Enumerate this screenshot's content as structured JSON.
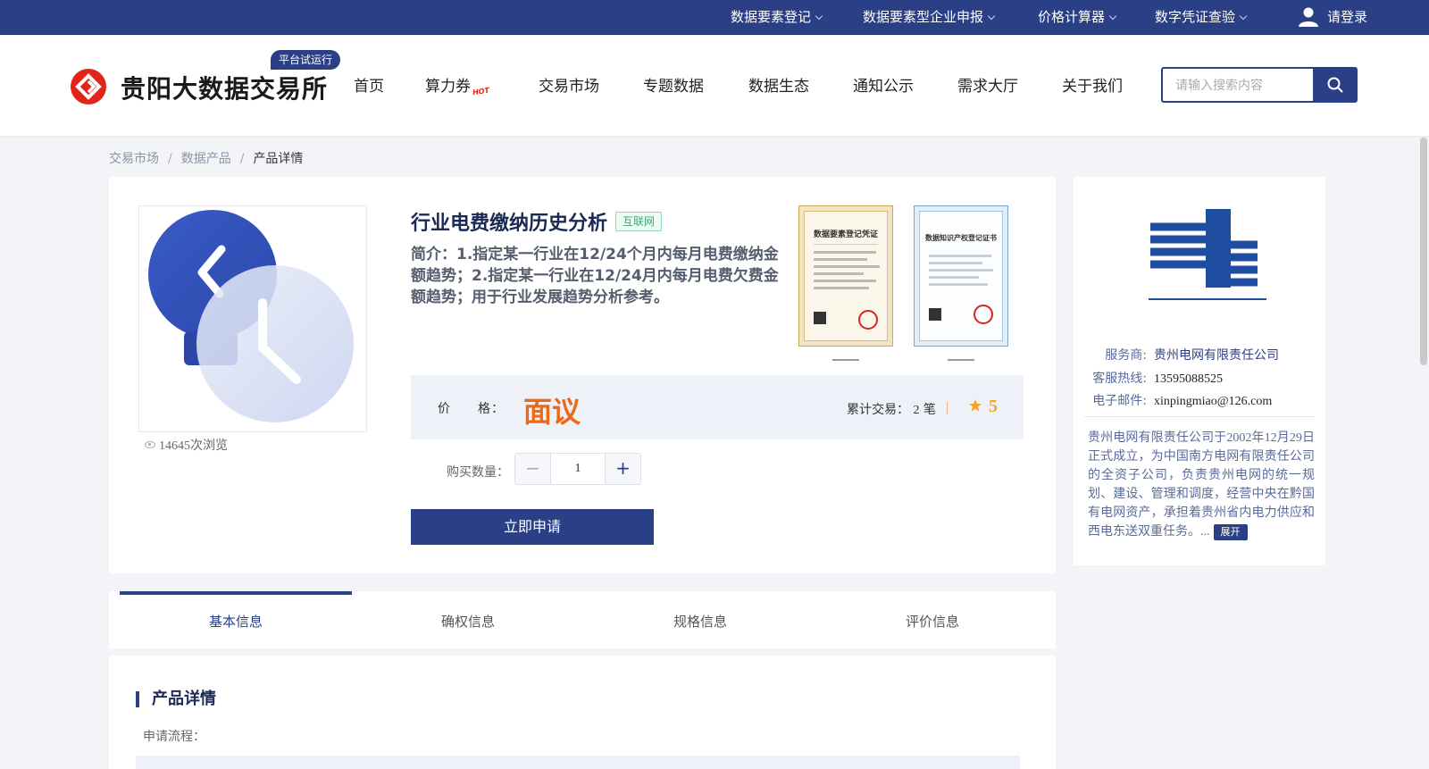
{
  "topbar": {
    "items": [
      {
        "label": "数据要素登记"
      },
      {
        "label": "数据要素型企业申报"
      },
      {
        "label": "价格计算器"
      },
      {
        "label": "数字凭证查验"
      }
    ],
    "login_label": "请登录"
  },
  "header": {
    "logo_text": "贵阳大数据交易所",
    "trial_badge": "平台试运行",
    "nav": [
      {
        "label": "首页"
      },
      {
        "label": "算力券",
        "hot": "HOT"
      },
      {
        "label": "交易市场"
      },
      {
        "label": "专题数据"
      },
      {
        "label": "数据生态"
      },
      {
        "label": "通知公示"
      },
      {
        "label": "需求大厅"
      },
      {
        "label": "关于我们"
      }
    ],
    "search_placeholder": "请输入搜索内容"
  },
  "breadcrumb": {
    "items": [
      "交易市场",
      "数据产品"
    ],
    "current": "产品详情",
    "separator": "/"
  },
  "product": {
    "title": "行业电费缴纳历史分析",
    "tag": "互联网",
    "description": "简介：1.指定某一行业在12/24个月内每月电费缴纳金额趋势；2.指定某一行业在12/24月内每月电费欠费金额趋势；用于行业发展趋势分析参考。",
    "views": "14645次浏览",
    "price_label": "价　　格：",
    "price_value": "面议",
    "trade_label": "累计交易：",
    "trade_count": "2",
    "trade_unit": "笔",
    "rating": "5",
    "qty_label": "购买数量：",
    "qty_value": "1",
    "apply_label": "立即申请",
    "cert1_title": "数据要素登记凭证",
    "cert2_title": "数据知识产权登记证书"
  },
  "provider": {
    "service_label": "服务商:",
    "service_value": "贵州电网有限责任公司",
    "hotline_label": "客服热线:",
    "hotline_value": "13595088525",
    "email_label": "电子邮件:",
    "email_value": "xinpingmiao@126.com",
    "description": "贵州电网有限责任公司于2002年12月29日正式成立，为中国南方电网有限责任公司的全资子公司，负责贵州电网的统一规划、建设、管理和调度，经营中央在黔国有电网资产，承担着贵州省内电力供应和西电东送双重任务。...",
    "expand_label": "展开"
  },
  "tabs": [
    {
      "label": "基本信息",
      "active": true
    },
    {
      "label": "确权信息"
    },
    {
      "label": "规格信息"
    },
    {
      "label": "评价信息"
    }
  ],
  "detail": {
    "title": "产品详情",
    "subtitle": "申请流程："
  },
  "colors": {
    "primary": "#2a3f85",
    "price": "#ea6a1a",
    "rating": "#f5a623",
    "logo_red": "#e1251b"
  }
}
